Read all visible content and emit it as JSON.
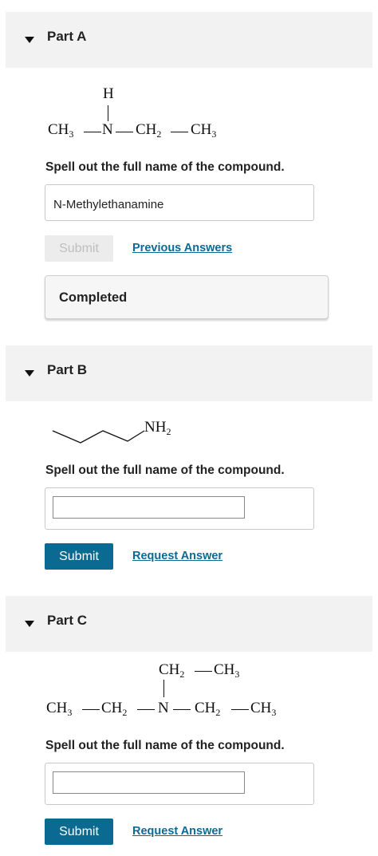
{
  "partA": {
    "title": "Part A",
    "structure": {
      "h": "H",
      "ch3_left": "CH",
      "n": "N",
      "ch2": "CH",
      "ch3_right": "CH",
      "sub3": "3",
      "sub2": "2"
    },
    "prompt": "Spell out the full name of the compound.",
    "answer_value": "N-Methylethanamine",
    "submit_label": "Submit",
    "link_label": "Previous Answers",
    "status": "Completed"
  },
  "partB": {
    "title": "Part B",
    "structure": {
      "nh": "NH",
      "sub2": "2"
    },
    "prompt": "Spell out the full name of the compound.",
    "answer_value": "",
    "submit_label": "Submit",
    "link_label": "Request Answer"
  },
  "partC": {
    "title": "Part C",
    "structure": {
      "top_ch2": "CH",
      "top_ch3": "CH",
      "ch3_left": "CH",
      "ch2_left": "CH",
      "n": "N",
      "ch2_right": "CH",
      "ch3_right": "CH",
      "sub3": "3",
      "sub2": "2"
    },
    "prompt": "Spell out the full name of the compound.",
    "answer_value": "",
    "submit_label": "Submit",
    "link_label": "Request Answer"
  },
  "colors": {
    "accent": "#0b6a92",
    "header_bg": "#f2f2f2"
  },
  "icons": {
    "collapse": "triangle-down-icon"
  }
}
